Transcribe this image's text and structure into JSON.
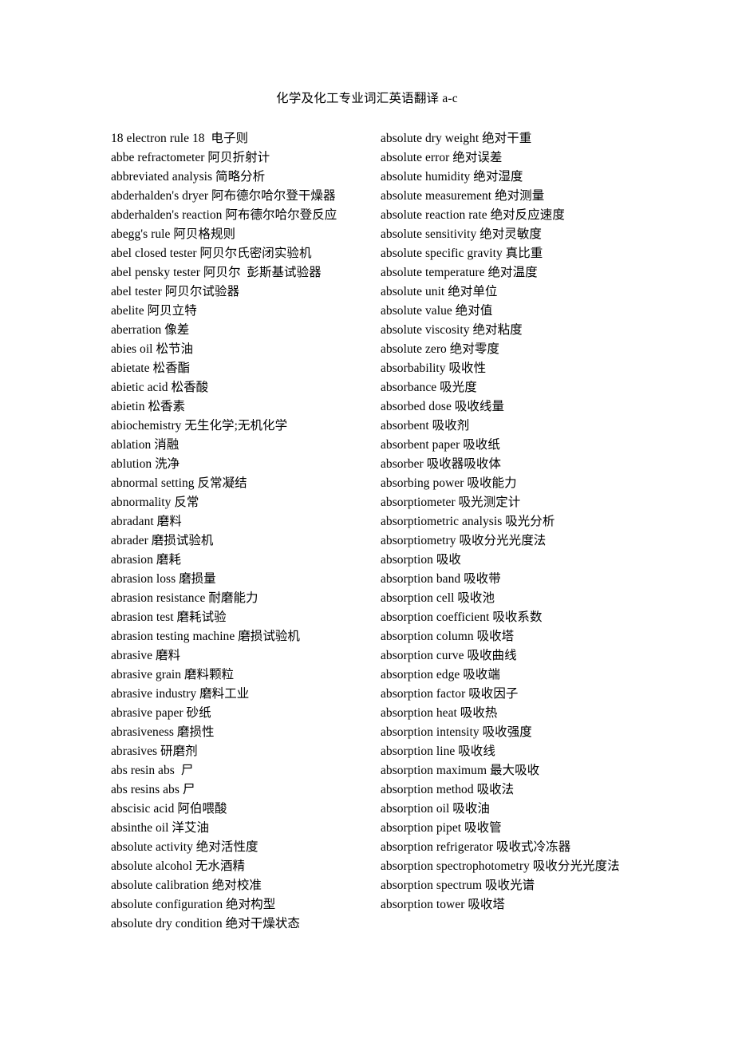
{
  "document": {
    "title": "化学及化工专业词汇英语翻译 a-c",
    "page_background": "#ffffff",
    "text_color": "#000000"
  },
  "columns": {
    "left": {
      "entries": [
        "18 electron rule 18  电子则",
        "abbe refractometer 阿贝折射计",
        "abbreviated analysis 简略分析",
        "abderhalden's dryer 阿布德尔哈尔登干燥器",
        "abderhalden's reaction 阿布德尔哈尔登反应",
        "abegg's rule 阿贝格规则",
        "abel closed tester 阿贝尔氏密闭实验机",
        "abel pensky tester 阿贝尔  彭斯基试验器",
        "abel tester 阿贝尔试验器",
        "abelite 阿贝立特",
        "aberration 像差",
        "abies oil 松节油",
        "abietate 松香酯",
        "abietic acid 松香酸",
        "abietin 松香素",
        "abiochemistry 无生化学;无机化学",
        "ablation 消融",
        "ablution 洗净",
        "abnormal setting 反常凝结",
        "abnormality 反常",
        "abradant 磨料",
        "abrader 磨损试验机",
        "abrasion 磨耗",
        "abrasion loss 磨损量",
        "abrasion resistance 耐磨能力",
        "abrasion test 磨耗试验",
        "abrasion testing machine 磨损试验机",
        "abrasive 磨料",
        "abrasive grain 磨料颗粒",
        "abrasive industry 磨料工业",
        "abrasive paper 砂纸",
        "abrasiveness 磨损性",
        "abrasives 研磨剂",
        "abs resin abs  尸",
        "abs resins abs 尸",
        "abscisic acid 阿伯喂酸",
        "absinthe oil 洋艾油",
        "absolute activity 绝对活性度",
        "absolute alcohol 无水酒精",
        "absolute calibration 绝对校准",
        "absolute configuration 绝对构型",
        "absolute dry condition 绝对干燥状态"
      ]
    },
    "right": {
      "entries": [
        "absolute dry weight 绝对干重",
        "absolute error 绝对误差",
        "absolute humidity 绝对湿度",
        "absolute measurement 绝对测量",
        "absolute reaction rate 绝对反应速度",
        "absolute sensitivity 绝对灵敏度",
        "absolute specific gravity 真比重",
        "absolute temperature 绝对温度",
        "absolute unit 绝对单位",
        "absolute value 绝对值",
        "absolute viscosity 绝对粘度",
        "absolute zero 绝对零度",
        "absorbability 吸收性",
        "absorbance 吸光度",
        "absorbed dose 吸收线量",
        "absorbent 吸收剂",
        "absorbent paper 吸收纸",
        "absorber 吸收器吸收体",
        "absorbing power 吸收能力",
        "absorptiometer 吸光测定计",
        "absorptiometric analysis 吸光分析",
        "absorptiometry 吸收分光光度法",
        "absorption 吸收",
        "absorption band 吸收带",
        "absorption cell 吸收池",
        "absorption coefficient 吸收系数",
        "absorption column 吸收塔",
        "absorption curve 吸收曲线",
        "absorption edge 吸收端",
        "absorption factor 吸收因子",
        "absorption heat 吸收热",
        "absorption intensity 吸收强度",
        "absorption line 吸收线",
        "absorption maximum 最大吸收",
        "absorption method 吸收法",
        "absorption oil 吸收油",
        "absorption pipet 吸收管",
        "absorption refrigerator 吸收式冷冻器",
        "absorption spectrophotometry 吸收分光光度法",
        "absorption spectrum 吸收光谱",
        "absorption tower 吸收塔"
      ],
      "wrapped_entry_index": 38
    }
  }
}
